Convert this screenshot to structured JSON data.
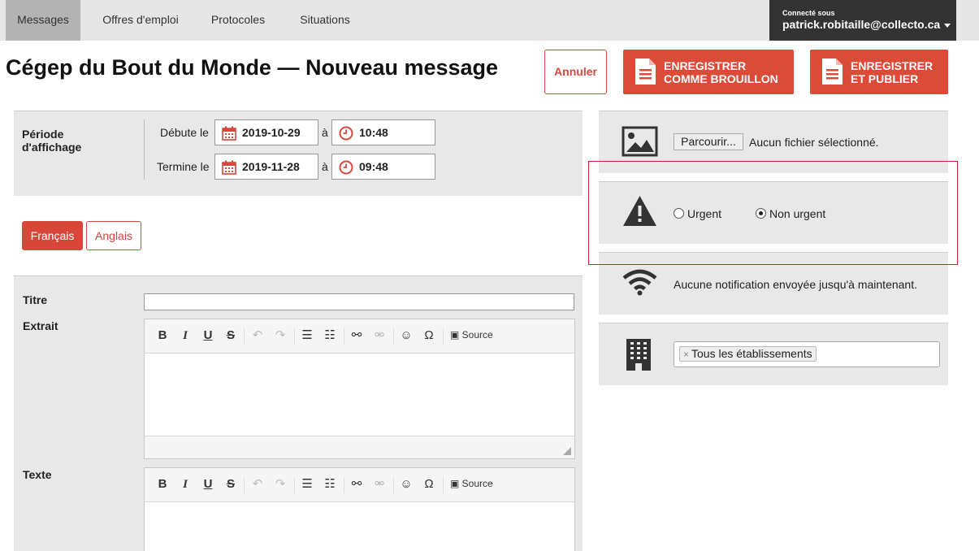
{
  "nav": {
    "tabs": [
      {
        "label": "Messages",
        "active": true
      },
      {
        "label": "Offres d'emploi",
        "active": false
      },
      {
        "label": "Protocoles",
        "active": false
      },
      {
        "label": "Situations",
        "active": false
      }
    ],
    "user": {
      "connected_label": "Connecté sous",
      "email": "patrick.robitaille@collecto.ca"
    }
  },
  "header": {
    "title": "Cégep du Bout du Monde — Nouveau message",
    "cancel_label": "Annuler",
    "draft_label": "ENREGISTRER\nCOMME BROUILLON",
    "publish_label": "ENREGISTRER\nET PUBLIER"
  },
  "period": {
    "label": "Période\nd'affichage",
    "start_label": "Débute le",
    "end_label": "Termine le",
    "a_label": "à",
    "start_date": "2019-10-29",
    "start_time": "10:48",
    "end_date": "2019-11-28",
    "end_time": "09:48"
  },
  "languages": [
    {
      "label": "Français",
      "active": true
    },
    {
      "label": "Anglais",
      "active": false
    }
  ],
  "form": {
    "title_label": "Titre",
    "title_value": "",
    "excerpt_label": "Extrait",
    "text_label": "Texte",
    "toolbar": {
      "bold": "B",
      "italic": "I",
      "underline": "U",
      "strike": "S",
      "undo": "↶",
      "redo": "↷",
      "ordered_list": "☰",
      "bullet_list": "☷",
      "link": "⚯",
      "unlink": "⚮",
      "emoji": "☺",
      "special_char": "Ω",
      "source": "Source"
    }
  },
  "sidebar": {
    "image": {
      "browse_label": "Parcourir...",
      "file_status": "Aucun fichier sélectionné."
    },
    "priority": {
      "options": [
        {
          "label": "Urgent",
          "selected": false
        },
        {
          "label": "Non urgent",
          "selected": true
        }
      ]
    },
    "notification": {
      "text": "Aucune notification envoyée jusqu'à maintenant."
    },
    "establishments": {
      "chip_label": "Tous les établissements",
      "remove_symbol": "×"
    }
  },
  "colors": {
    "accent": "#dc4a38",
    "nav_bg": "#e6e6e6",
    "user_bg": "#333333",
    "panel_bg": "#e8e8e8",
    "highlight": "#d42020"
  }
}
